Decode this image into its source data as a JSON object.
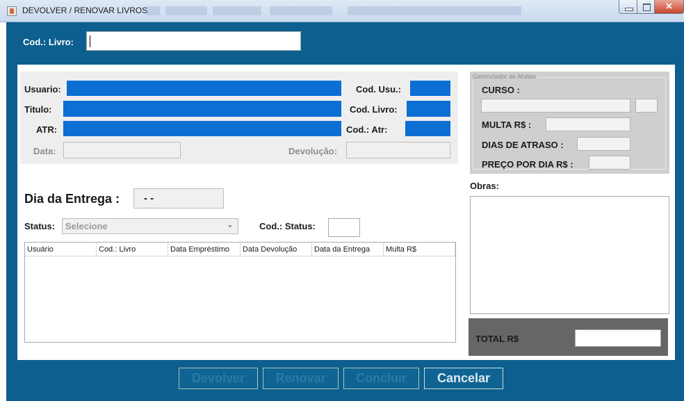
{
  "window": {
    "title": "DEVOLVER / RENOVAR LIVROS"
  },
  "top": {
    "cod_livro_label": "Cod.: Livro:",
    "cod_livro_value": ""
  },
  "info": {
    "usuario_label": "Usuario:",
    "titulo_label": "Titulo:",
    "atr_label": "ATR:",
    "data_label": "Data:",
    "cod_usu_label": "Cod. Usu.:",
    "cod_livro_label": "Cod. Livro:",
    "cod_atr_label": "Cod.: Atr:",
    "devolucao_label": "Devolução:"
  },
  "entrega": {
    "label": "Dia da Entrega :",
    "value": "- -"
  },
  "status": {
    "label": "Status:",
    "selected": "Selecione",
    "cod_label": "Cod.: Status:"
  },
  "table": {
    "columns": [
      "Usuário",
      "Cod.: Livro",
      "Data Empréstimo",
      "Data Devolução",
      "Data da Entrega",
      "Multa R$"
    ]
  },
  "multas": {
    "legend": "Gerenciador de Multas",
    "curso_label": "CURSO :",
    "multa_label": "MULTA R$ :",
    "dias_label": "DIAS DE ATRASO :",
    "preco_label": "PREÇO POR DIA R$ :"
  },
  "obras": {
    "label": "Obras:"
  },
  "total": {
    "label": "TOTAL R$"
  },
  "buttons": {
    "devolver": "Devolver",
    "renovar": "Renovar",
    "concluir": "Concluir",
    "cancelar": "Cancelar"
  },
  "colors": {
    "frame": "#0d5f8f",
    "field_blue": "#0b6fd3",
    "total_panel": "#666666"
  }
}
